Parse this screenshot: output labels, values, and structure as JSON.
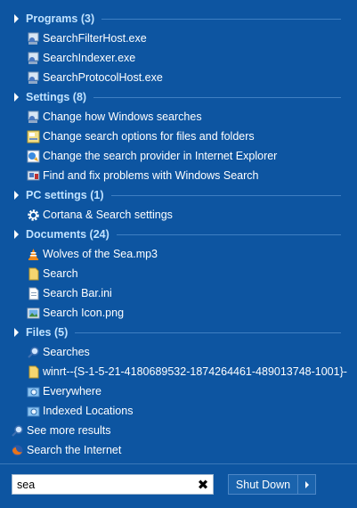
{
  "categories": [
    {
      "label": "Programs (3)",
      "items": [
        {
          "label": "SearchFilterHost.exe",
          "icon": "program-exe-icon"
        },
        {
          "label": "SearchIndexer.exe",
          "icon": "program-exe-icon"
        },
        {
          "label": "SearchProtocolHost.exe",
          "icon": "program-exe-icon"
        }
      ]
    },
    {
      "label": "Settings (8)",
      "items": [
        {
          "label": "Change how Windows searches",
          "icon": "search-settings-icon"
        },
        {
          "label": "Change search options for files and folders",
          "icon": "folder-options-icon"
        },
        {
          "label": "Change the search provider in Internet Explorer",
          "icon": "internet-options-icon"
        },
        {
          "label": "Find and fix problems with Windows Search",
          "icon": "troubleshoot-icon"
        }
      ]
    },
    {
      "label": "PC settings (1)",
      "items": [
        {
          "label": "Cortana & Search settings",
          "icon": "gear-icon"
        }
      ]
    },
    {
      "label": "Documents (24)",
      "items": [
        {
          "label": "Wolves of the Sea.mp3",
          "icon": "vlc-cone-icon"
        },
        {
          "label": "Search",
          "icon": "document-icon"
        },
        {
          "label": "Search Bar.ini",
          "icon": "document-icon"
        },
        {
          "label": "Search Icon.png",
          "icon": "image-file-icon"
        }
      ]
    },
    {
      "label": "Files (5)",
      "items": [
        {
          "label": "Searches",
          "icon": "magnifier-icon"
        },
        {
          "label": "winrt--{S-1-5-21-4180689532-1874264461-489013748-1001}-",
          "icon": "document-icon"
        },
        {
          "label": "Everywhere",
          "icon": "search-folder-icon"
        },
        {
          "label": "Indexed Locations",
          "icon": "search-folder-icon"
        }
      ]
    }
  ],
  "bottom_links": {
    "see_more": "See more results",
    "search_internet": "Search the Internet"
  },
  "search": {
    "value": "sea"
  },
  "shutdown": {
    "label": "Shut Down"
  },
  "colors": {
    "background": "#0d55a1",
    "category_text": "#bfe2ff",
    "divider": "#3f7fc2"
  }
}
